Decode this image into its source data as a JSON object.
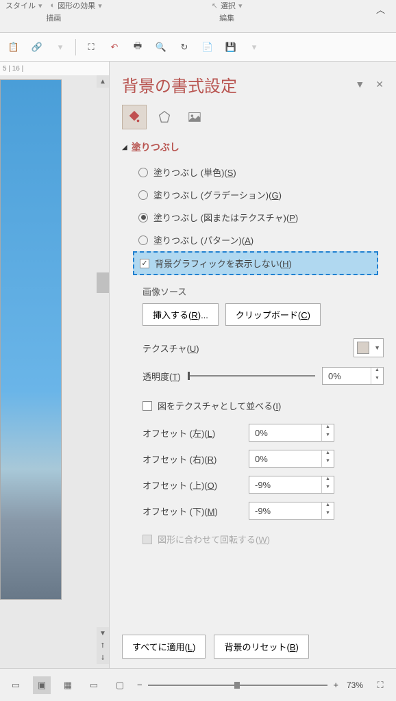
{
  "ribbon": {
    "style_label": "スタイル",
    "effects_label": "図形の効果",
    "drawing_group": "描画",
    "select_label": "選択",
    "edit_group": "編集"
  },
  "panel": {
    "title": "背景の書式設定"
  },
  "fill": {
    "section_title": "塗りつぶし",
    "solid": "塗りつぶし (単色)(",
    "solid_key": "S",
    "gradient": "塗りつぶし (グラデーション)(",
    "gradient_key": "G",
    "picture": "塗りつぶし (図またはテクスチャ)(",
    "picture_key": "P",
    "pattern": "塗りつぶし (パターン)(",
    "pattern_key": "A",
    "hide_bg": "背景グラフィックを表示しない(",
    "hide_bg_key": "H"
  },
  "image": {
    "source_label": "画像ソース",
    "insert_btn": "挿入する(",
    "insert_key": "R",
    "insert_suffix": ")...",
    "clipboard_btn": "クリップボード(",
    "clipboard_key": "C",
    "texture_label": "テクスチャ(",
    "texture_key": "U",
    "transparency_label": "透明度(",
    "transparency_key": "T",
    "transparency_value": "0%",
    "tile_label": "図をテクスチャとして並べる(",
    "tile_key": "I"
  },
  "offsets": {
    "left_label": "オフセット (左)(",
    "left_key": "L",
    "left_value": "0%",
    "right_label": "オフセット (右)(",
    "right_key": "R",
    "right_value": "0%",
    "top_label": "オフセット (上)(",
    "top_key": "O",
    "top_value": "-9%",
    "bottom_label": "オフセット (下)(",
    "bottom_key": "M",
    "bottom_value": "-9%",
    "rotate_label": "図形に合わせて回転する(",
    "rotate_key": "W"
  },
  "buttons": {
    "apply_all": "すべてに適用(",
    "apply_all_key": "L",
    "reset_bg": "背景のリセット(",
    "reset_bg_key": "B"
  },
  "status": {
    "zoom": "73%"
  },
  "ruler": {
    "marks": "5 | 16 |"
  }
}
